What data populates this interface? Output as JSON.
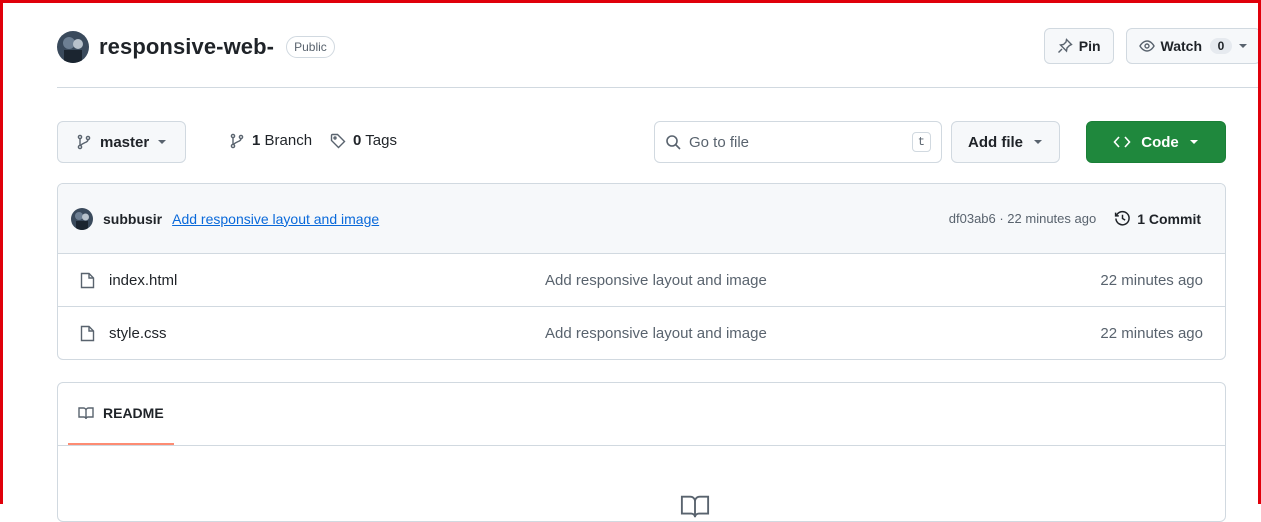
{
  "header": {
    "repo_name": "responsive-web-",
    "visibility_badge": "Public",
    "pin_label": "Pin",
    "watch_label": "Watch",
    "watch_count": "0"
  },
  "toolbar": {
    "branch": "master",
    "branches_count": "1",
    "branches_label": "Branch",
    "tags_count": "0",
    "tags_label": "Tags",
    "search_placeholder": "Go to file",
    "search_shortcut": "t",
    "add_file_label": "Add file",
    "code_label": "Code"
  },
  "latest_commit": {
    "author": "subbusir",
    "message": "Add responsive layout and image",
    "hash_time": "df03ab6 · 22 minutes ago",
    "commit_count_label": "1 Commit"
  },
  "files": [
    {
      "name": "index.html",
      "message": "Add responsive layout and image",
      "age": "22 minutes ago"
    },
    {
      "name": "style.css",
      "message": "Add responsive layout and image",
      "age": "22 minutes ago"
    }
  ],
  "readme": {
    "tab_label": "README"
  },
  "colors": {
    "code_button": "#1f883d",
    "link": "#0969da",
    "readme_underline": "#fd8c73",
    "frame": "#e0000b"
  },
  "icons": {
    "pin": "pin-icon",
    "watch": "eye-icon",
    "branch": "git-branch-icon",
    "tag": "tag-icon",
    "search": "search-icon",
    "file": "file-icon",
    "history": "history-icon",
    "book": "book-icon"
  }
}
